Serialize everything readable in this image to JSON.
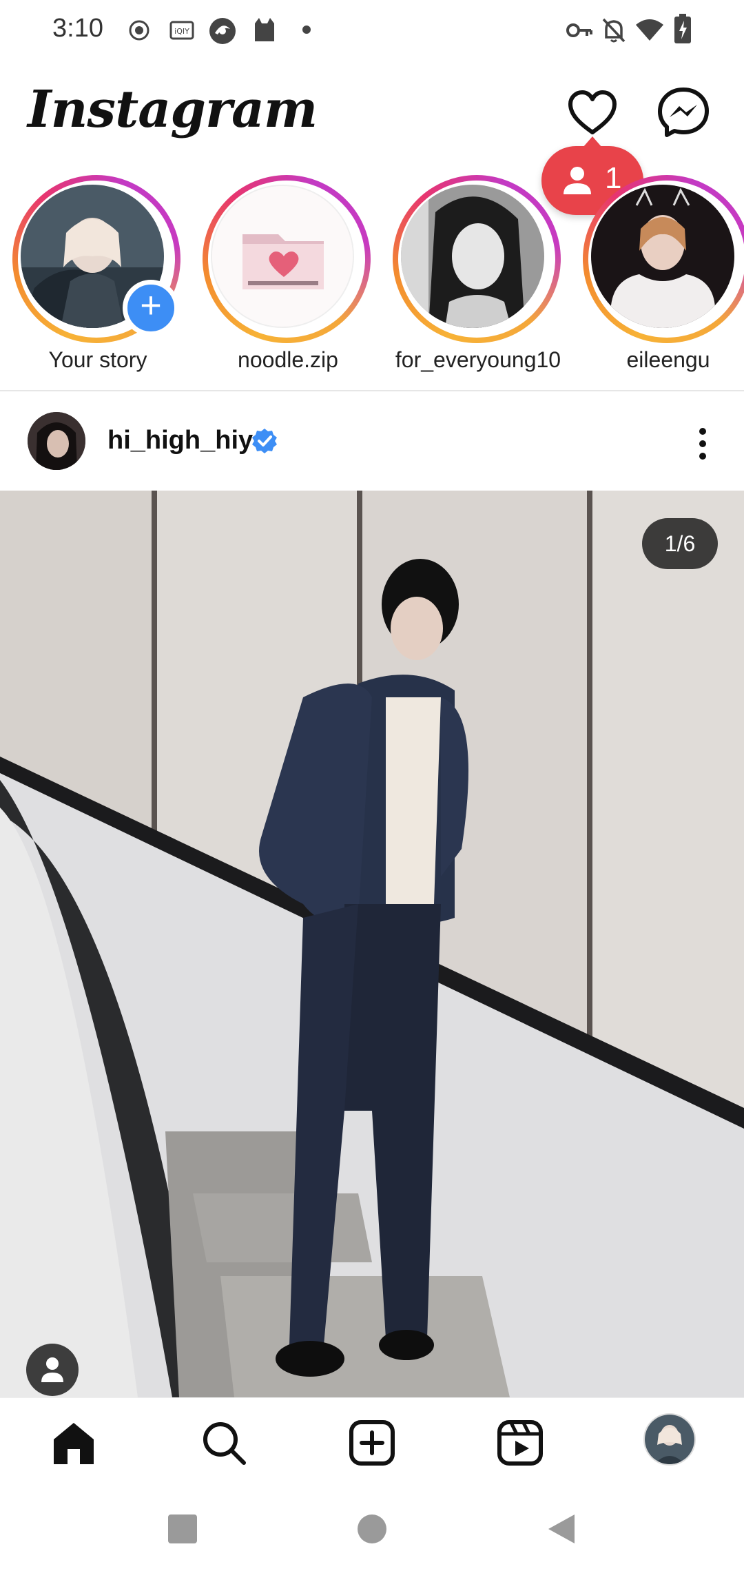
{
  "status_bar": {
    "time": "3:10",
    "left_icons": [
      "record-icon",
      "iqiyi-icon",
      "browser-icon",
      "cat-app-icon",
      "dot-icon"
    ],
    "right_icons": [
      "vpn-key-icon",
      "silent-bell-icon",
      "wifi-icon",
      "battery-charging-icon"
    ]
  },
  "header": {
    "logo_text": "Instagram",
    "notifications_icon": "heart-icon",
    "messenger_icon": "messenger-icon",
    "follow_request_count": "1"
  },
  "stories": [
    {
      "label": "Your story",
      "has_add_badge": true,
      "ring": false
    },
    {
      "label": "noodle.zip",
      "ring": true
    },
    {
      "label": "for_everyoung10",
      "ring": true
    },
    {
      "label": "eileengu",
      "ring": true
    }
  ],
  "post": {
    "username": "hi_high_hiy",
    "verified": true,
    "image_counter": "1/6"
  },
  "bottom_nav": [
    "home-icon",
    "search-icon",
    "create-icon",
    "reels-icon",
    "profile-avatar"
  ],
  "system_nav": [
    "recents-icon",
    "home-circle-icon",
    "back-icon"
  ],
  "colors": {
    "notification_red": "#e8434a",
    "verified_blue": "#3d8ef5",
    "story_ring_gradient": [
      "#f7b236",
      "#e7356f",
      "#c33ac4"
    ]
  }
}
